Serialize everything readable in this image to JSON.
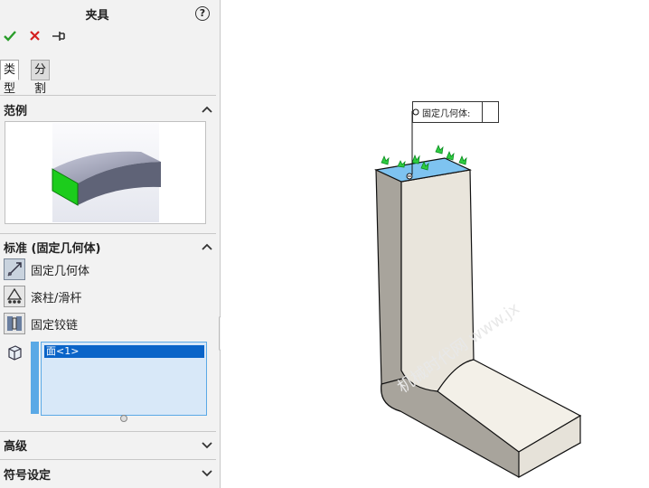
{
  "panel": {
    "title": "夹具",
    "help_label": "?",
    "actions": {
      "ok_icon": "check-icon",
      "cancel_icon": "x-icon",
      "pin_icon": "pin-icon"
    },
    "tabs": [
      {
        "label": "类型",
        "active": true
      },
      {
        "label": "分割",
        "active": false
      }
    ],
    "sections": {
      "scope": {
        "label": "范例"
      },
      "standard": {
        "label": "标准 (固定几何体)",
        "options": [
          {
            "label": "固定几何体",
            "icon": "fixed-geometry-icon",
            "selected": true
          },
          {
            "label": "滚柱/滑杆",
            "icon": "roller-slider-icon"
          },
          {
            "label": "固定铰链",
            "icon": "fixed-hinge-icon"
          }
        ],
        "selection": {
          "icon": "face-icon",
          "items": [
            "面<1>"
          ]
        }
      },
      "advanced": {
        "label": "高级"
      },
      "symbol": {
        "label": "符号设定"
      }
    }
  },
  "viewport": {
    "callout": {
      "label": "固定几何体:"
    },
    "colors": {
      "fixture_green": "#2ecc40",
      "selected_face": "#7ec3f0",
      "part_face": "#e9e5dc"
    }
  }
}
